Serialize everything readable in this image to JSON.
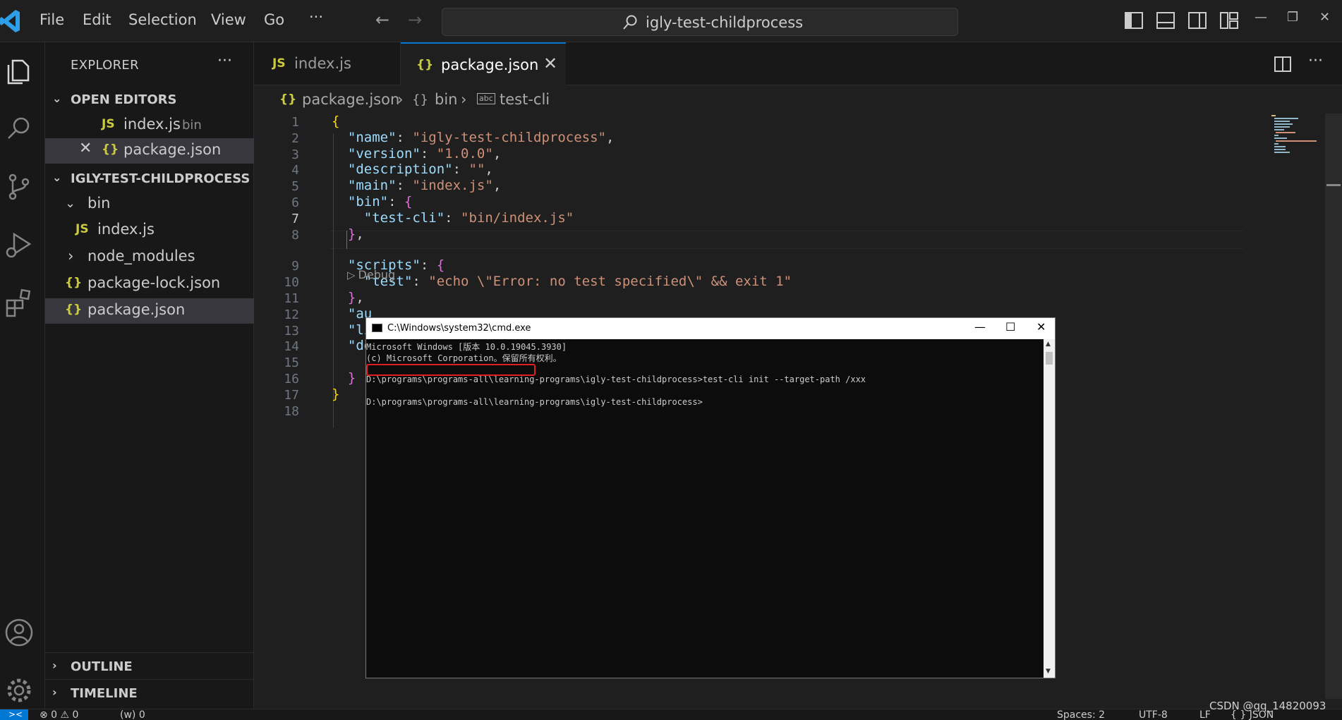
{
  "menu": [
    "File",
    "Edit",
    "Selection",
    "View",
    "Go"
  ],
  "menu_more": "···",
  "command_center": "igly-test-childprocess",
  "sidebar": {
    "title": "EXPLORER",
    "more": "···",
    "open_editors_label": "OPEN EDITORS",
    "open_editors": [
      {
        "icon": "JS",
        "name": "index.js",
        "desc": "bin"
      },
      {
        "icon": "{}",
        "name": "package.json",
        "close": "✕"
      }
    ],
    "folder_label": "IGLY-TEST-CHILDPROCESS",
    "tree": [
      {
        "chev": "⌄",
        "icon": "",
        "name": "bin"
      },
      {
        "chev": "",
        "icon": "JS",
        "name": "index.js"
      },
      {
        "chev": "›",
        "icon": "",
        "name": "node_modules"
      },
      {
        "chev": "",
        "icon": "{}",
        "name": "package-lock.json"
      },
      {
        "chev": "",
        "icon": "{}",
        "name": "package.json"
      }
    ],
    "outline_label": "OUTLINE",
    "timeline_label": "TIMELINE"
  },
  "tabs": [
    {
      "icon": "JS",
      "name": "index.js"
    },
    {
      "icon": "{}",
      "name": "package.json",
      "close": "✕"
    }
  ],
  "breadcrumb": {
    "file_icon": "{}",
    "file": "package.json",
    "sep": "›",
    "obj_icon": "{}",
    "obj": "bin",
    "key_icon": "abc",
    "key": "test-cli"
  },
  "codelens": "Debug",
  "line_numbers": [
    "1",
    "2",
    "3",
    "4",
    "5",
    "6",
    "7",
    "8",
    "9",
    "10",
    "11",
    "12",
    "13",
    "14",
    "15",
    "16",
    "17",
    "18"
  ],
  "code_lines": [
    {
      "parts": [
        {
          "c": "b1",
          "t": "{"
        }
      ]
    },
    {
      "parts": [
        {
          "c": "p",
          "t": "  "
        },
        {
          "c": "k",
          "t": "\"name\""
        },
        {
          "c": "p",
          "t": ": "
        },
        {
          "c": "s",
          "t": "\"igly-test-childprocess\""
        },
        {
          "c": "p",
          "t": ","
        }
      ]
    },
    {
      "parts": [
        {
          "c": "p",
          "t": "  "
        },
        {
          "c": "k",
          "t": "\"version\""
        },
        {
          "c": "p",
          "t": ": "
        },
        {
          "c": "s",
          "t": "\"1.0.0\""
        },
        {
          "c": "p",
          "t": ","
        }
      ]
    },
    {
      "parts": [
        {
          "c": "p",
          "t": "  "
        },
        {
          "c": "k",
          "t": "\"description\""
        },
        {
          "c": "p",
          "t": ": "
        },
        {
          "c": "s",
          "t": "\"\""
        },
        {
          "c": "p",
          "t": ","
        }
      ]
    },
    {
      "parts": [
        {
          "c": "p",
          "t": "  "
        },
        {
          "c": "k",
          "t": "\"main\""
        },
        {
          "c": "p",
          "t": ": "
        },
        {
          "c": "s",
          "t": "\"index.js\""
        },
        {
          "c": "p",
          "t": ","
        }
      ]
    },
    {
      "parts": [
        {
          "c": "p",
          "t": "  "
        },
        {
          "c": "k",
          "t": "\"bin\""
        },
        {
          "c": "p",
          "t": ": "
        },
        {
          "c": "b2",
          "t": "{"
        }
      ]
    },
    {
      "parts": [
        {
          "c": "p",
          "t": "    "
        },
        {
          "c": "k",
          "t": "\"test-cli\""
        },
        {
          "c": "p",
          "t": ": "
        },
        {
          "c": "s",
          "t": "\"bin/index.js\""
        }
      ]
    },
    {
      "parts": [
        {
          "c": "p",
          "t": "  "
        },
        {
          "c": "b2",
          "t": "}"
        },
        {
          "c": "p",
          "t": ","
        }
      ]
    },
    {
      "parts": [
        {
          "c": "p",
          "t": "  "
        },
        {
          "c": "k",
          "t": "\"scripts\""
        },
        {
          "c": "p",
          "t": ": "
        },
        {
          "c": "b2",
          "t": "{"
        }
      ]
    },
    {
      "parts": [
        {
          "c": "p",
          "t": "    "
        },
        {
          "c": "k",
          "t": "\"test\""
        },
        {
          "c": "p",
          "t": ": "
        },
        {
          "c": "s",
          "t": "\"echo \\\"Error: no test specified\\\" && exit 1\""
        }
      ]
    },
    {
      "parts": [
        {
          "c": "p",
          "t": "  "
        },
        {
          "c": "b2",
          "t": "}"
        },
        {
          "c": "p",
          "t": ","
        }
      ]
    },
    {
      "parts": [
        {
          "c": "p",
          "t": "  "
        },
        {
          "c": "k",
          "t": "\"au"
        }
      ]
    },
    {
      "parts": [
        {
          "c": "p",
          "t": "  "
        },
        {
          "c": "k",
          "t": "\"li"
        }
      ]
    },
    {
      "parts": [
        {
          "c": "p",
          "t": "  "
        },
        {
          "c": "k",
          "t": "\"de"
        }
      ]
    },
    {
      "parts": [
        {
          "c": "p",
          "t": "    "
        }
      ]
    },
    {
      "parts": [
        {
          "c": "p",
          "t": "  "
        },
        {
          "c": "b2",
          "t": "}"
        }
      ]
    },
    {
      "parts": [
        {
          "c": "b1",
          "t": "}"
        }
      ]
    },
    {
      "parts": []
    }
  ],
  "cmd": {
    "title": "C:\\Windows\\system32\\cmd.exe",
    "minimize": "—",
    "maximize": "☐",
    "close": "✕",
    "lines": [
      "Microsoft Windows [版本 10.0.19045.3930]",
      "(c) Microsoft Corporation。保留所有权利。",
      "",
      "D:\\programs\\programs-all\\learning-programs\\igly-test-childprocess>test-cli init --target-path /xxx",
      "",
      "D:\\programs\\programs-all\\learning-programs\\igly-test-childprocess>"
    ]
  },
  "statusbar": {
    "errors": "⊗ 0 ⚠ 0",
    "ports": "(w) 0",
    "spaces": "Spaces: 2",
    "encoding": "UTF-8",
    "eol": "LF",
    "lang": "{ } JSON"
  },
  "watermark": "CSDN @qq_14820093",
  "colors": {
    "accent": "#0078d4",
    "bg": "#1f1f1f",
    "sidebar": "#181818",
    "redbox": "#e02020"
  }
}
